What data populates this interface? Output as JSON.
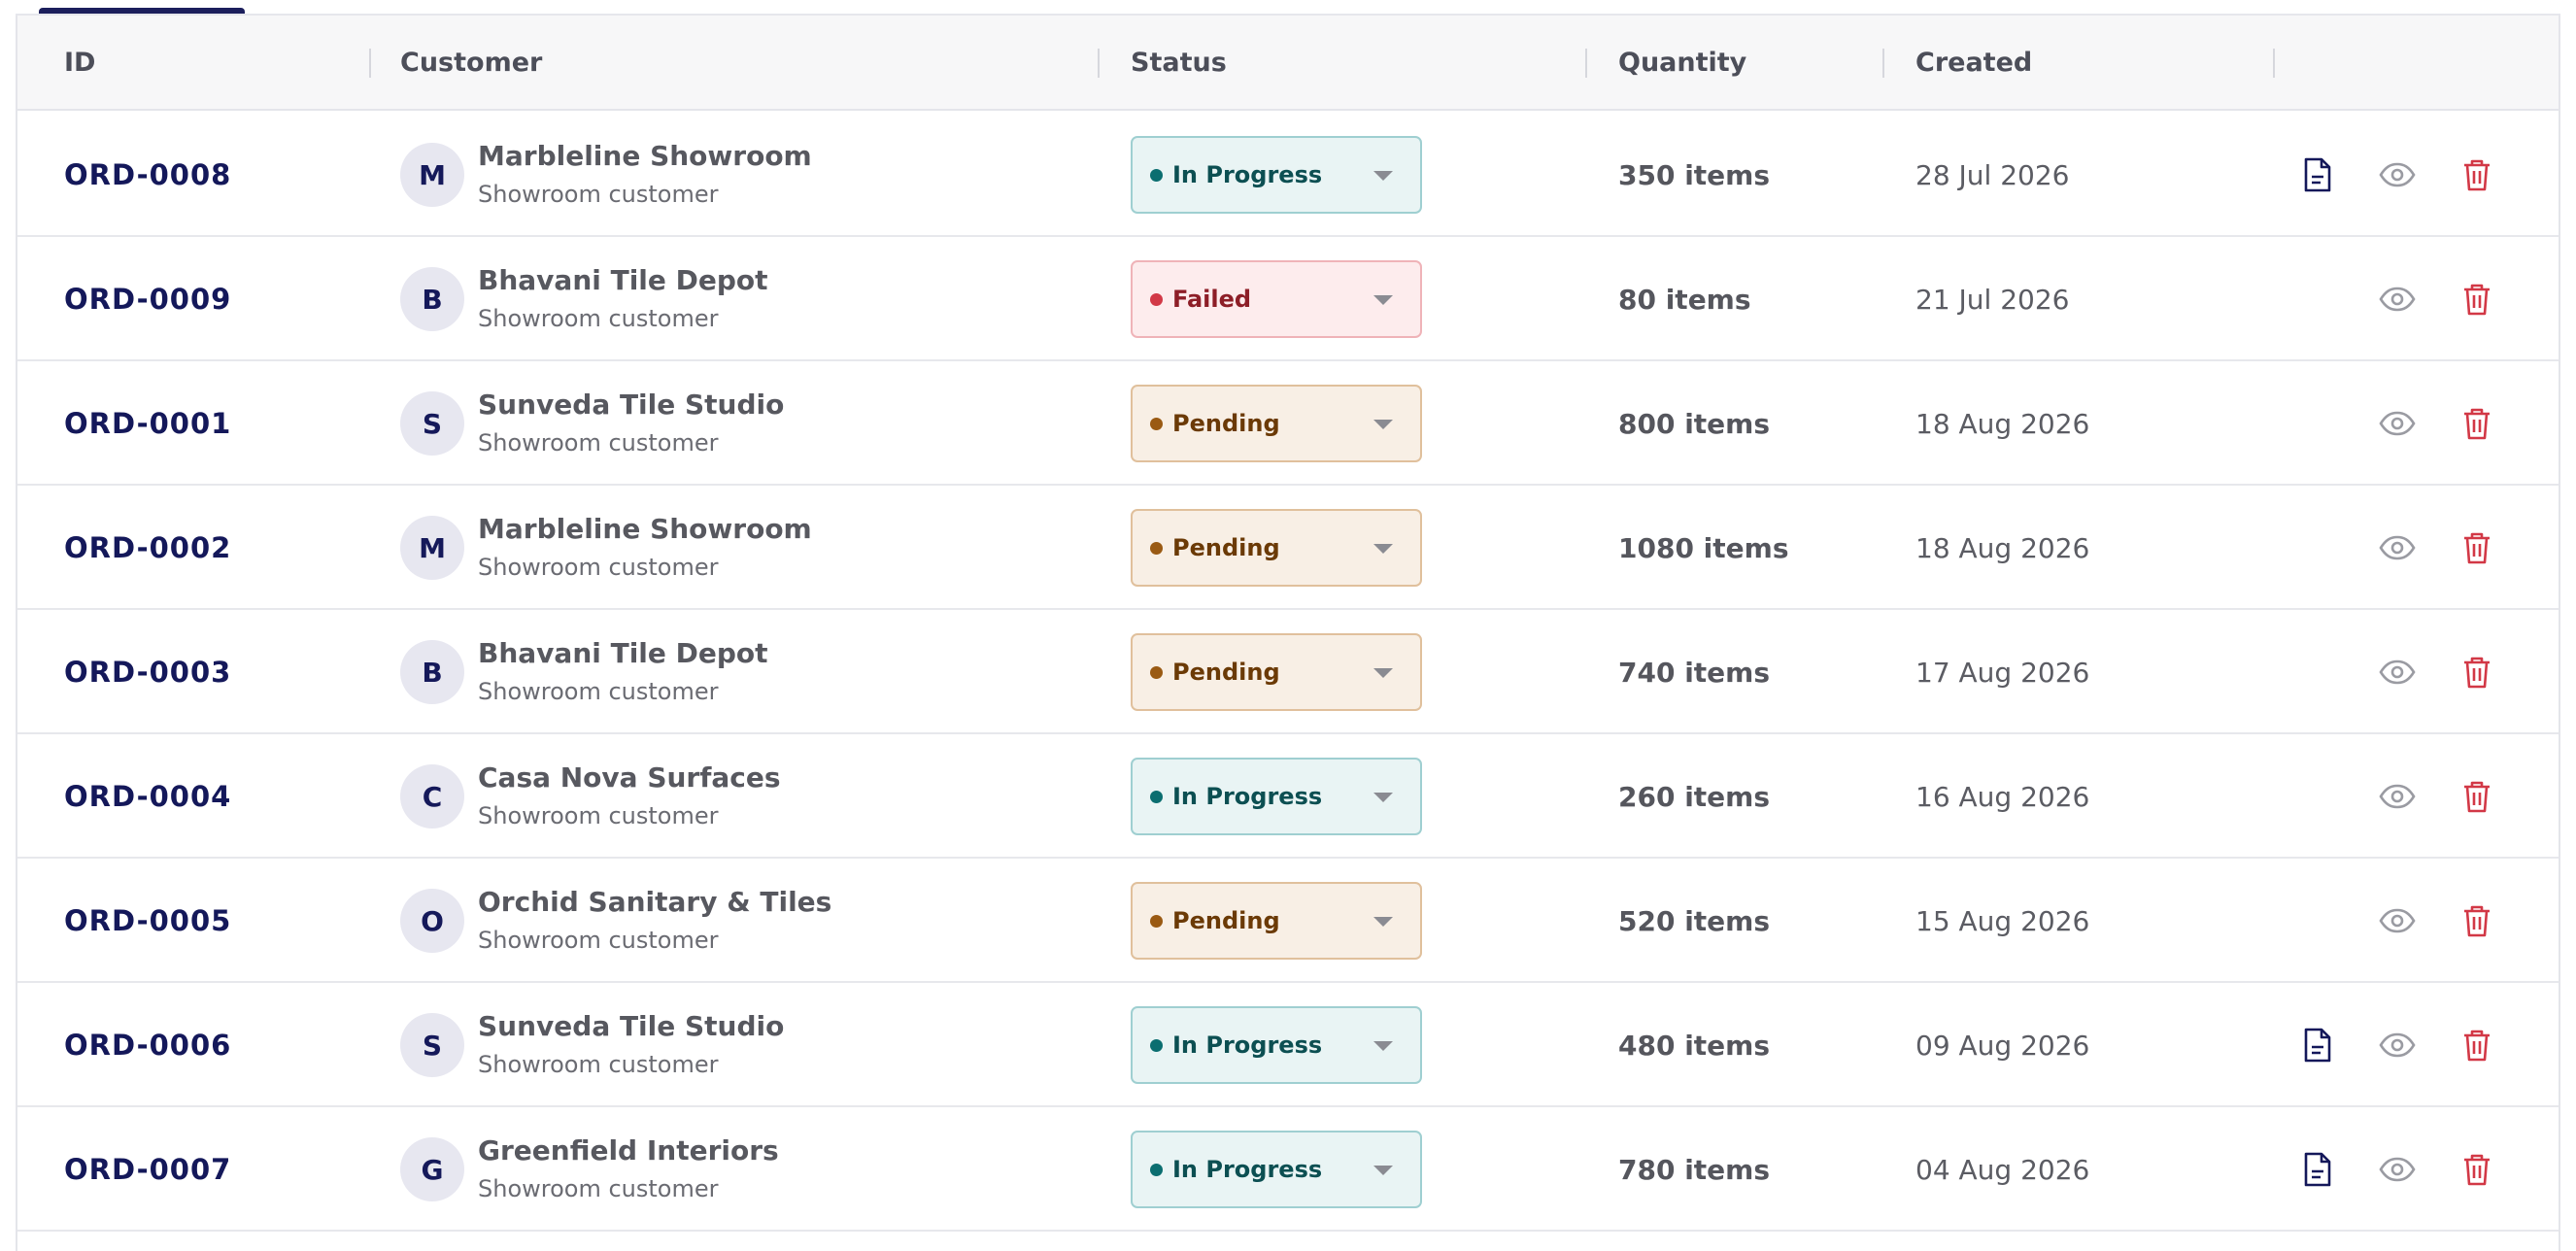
{
  "table": {
    "headers": {
      "id": "ID",
      "customer": "Customer",
      "status": "Status",
      "quantity": "Quantity",
      "created": "Created"
    },
    "rows": [
      {
        "id": "ORD-0008",
        "initial": "M",
        "customer": "Marbleline Showroom",
        "subtitle": "Showroom customer",
        "status": "In Progress",
        "status_kind": "progress",
        "quantity": "350 items",
        "created": "28 Jul 2026",
        "has_doc": true
      },
      {
        "id": "ORD-0009",
        "initial": "B",
        "customer": "Bhavani Tile Depot",
        "subtitle": "Showroom customer",
        "status": "Failed",
        "status_kind": "failed",
        "quantity": "80 items",
        "created": "21 Jul 2026",
        "has_doc": false
      },
      {
        "id": "ORD-0001",
        "initial": "S",
        "customer": "Sunveda Tile Studio",
        "subtitle": "Showroom customer",
        "status": "Pending",
        "status_kind": "pending",
        "quantity": "800 items",
        "created": "18 Aug 2026",
        "has_doc": false
      },
      {
        "id": "ORD-0002",
        "initial": "M",
        "customer": "Marbleline Showroom",
        "subtitle": "Showroom customer",
        "status": "Pending",
        "status_kind": "pending",
        "quantity": "1080 items",
        "created": "18 Aug 2026",
        "has_doc": false
      },
      {
        "id": "ORD-0003",
        "initial": "B",
        "customer": "Bhavani Tile Depot",
        "subtitle": "Showroom customer",
        "status": "Pending",
        "status_kind": "pending",
        "quantity": "740 items",
        "created": "17 Aug 2026",
        "has_doc": false
      },
      {
        "id": "ORD-0004",
        "initial": "C",
        "customer": "Casa Nova Surfaces",
        "subtitle": "Showroom customer",
        "status": "In Progress",
        "status_kind": "progress",
        "quantity": "260 items",
        "created": "16 Aug 2026",
        "has_doc": false
      },
      {
        "id": "ORD-0005",
        "initial": "O",
        "customer": "Orchid Sanitary & Tiles",
        "subtitle": "Showroom customer",
        "status": "Pending",
        "status_kind": "pending",
        "quantity": "520 items",
        "created": "15 Aug 2026",
        "has_doc": false
      },
      {
        "id": "ORD-0006",
        "initial": "S",
        "customer": "Sunveda Tile Studio",
        "subtitle": "Showroom customer",
        "status": "In Progress",
        "status_kind": "progress",
        "quantity": "480 items",
        "created": "09 Aug 2026",
        "has_doc": true
      },
      {
        "id": "ORD-0007",
        "initial": "G",
        "customer": "Greenfield Interiors",
        "subtitle": "Showroom customer",
        "status": "In Progress",
        "status_kind": "progress",
        "quantity": "780 items",
        "created": "04 Aug 2026",
        "has_doc": true
      }
    ]
  },
  "icons": {
    "document": "document-icon",
    "view": "eye-icon",
    "delete": "trash-icon"
  },
  "colors": {
    "accent": "#1c1f5c",
    "in_progress": "#0b6e70",
    "failed": "#d23846",
    "pending": "#9a5a13",
    "delete": "#d23846"
  }
}
